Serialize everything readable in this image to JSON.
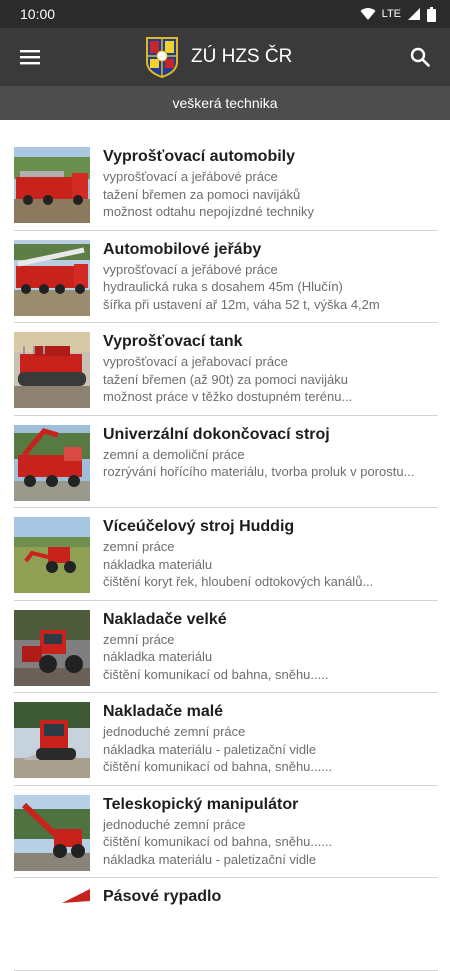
{
  "status": {
    "time": "10:00",
    "network": "LTE"
  },
  "app": {
    "title": "ZÚ HZS ČR",
    "subtitle": "veškerá technika"
  },
  "items": [
    {
      "title": "Vyprošťovací automobily",
      "lines": [
        "vyprošťovací a jeřábové práce",
        "tažení břemen za pomoci navijáků",
        "možnost odtahu nepojízdné techniky"
      ]
    },
    {
      "title": "Automobilové jeřáby",
      "lines": [
        "vyprošťovací a jeřábové práce",
        "hydraulická ruka s dosahem 45m (Hlučín)",
        "šířka při ustavení ař 12m, váha 52 t, výška 4,2m"
      ]
    },
    {
      "title": "Vyprošťovací tank",
      "lines": [
        "vyprošťovací a jeřabovací práce",
        "tažení břemen (až 90t) za pomoci navijáku",
        "možnost práce v těžko dostupném terénu..."
      ]
    },
    {
      "title": "Univerzální dokončovací stroj",
      "lines": [
        "zemní a demoliční práce",
        "rozrývání hořícího materiálu, tvorba proluk v porostu..."
      ]
    },
    {
      "title": "Víceúčelový stroj Huddig",
      "lines": [
        "zemní práce",
        "nákladka materiálu",
        "čištění koryt řek, hloubení odtokových kanálů..."
      ]
    },
    {
      "title": "Nakladače velké",
      "lines": [
        "zemní práce",
        "nákladka materiálu",
        "čištění komunikací od bahna, sněhu....."
      ]
    },
    {
      "title": "Nakladače malé",
      "lines": [
        "jednoduché zemní práce",
        "nákladka materiálu - paletizační vidle",
        "čištění komunikací od bahna, sněhu......"
      ]
    },
    {
      "title": "Teleskopický manipulátor",
      "lines": [
        "jednoduché zemní práce",
        "čištění komunikací od bahna, sněhu......",
        "nákladka materiálu - paletizační vidle"
      ]
    },
    {
      "title": "Pásové rypadlo",
      "lines": []
    }
  ],
  "icons": {
    "menu": "menu-icon",
    "search": "search-icon",
    "logo": "fire-rescue-emblem-logo"
  },
  "colors": {
    "status_bar": "#2b2b2b",
    "app_bar": "#3a3a3a",
    "subheader": "#4d4d4d",
    "accent_red": "#c62828"
  }
}
